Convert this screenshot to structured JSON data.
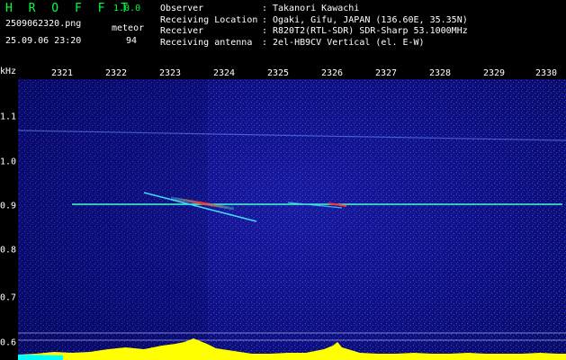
{
  "header": {
    "app_name": "H R O F F T",
    "version": "1.0.0",
    "filename": "2509062320.png",
    "datetime": "25.09.06 23:20",
    "detection_label": "meteor",
    "detection_count": "94",
    "info": [
      {
        "label": "Observer",
        "sep": ":",
        "value": "Takanori Kawachi"
      },
      {
        "label": "Receiving Location",
        "sep": ":",
        "value": "Ogaki, Gifu, JAPAN (136.60E, 35.35N)"
      },
      {
        "label": "Receiver",
        "sep": ":",
        "value": "R820T2(RTL-SDR) SDR-Sharp 53.1000MHz"
      },
      {
        "label": "Receiving antenna",
        "sep": ":",
        "value": "2el-HB9CV Vertical (el. E-W)"
      }
    ]
  },
  "axis": {
    "unit": "kHz",
    "time_ticks": [
      "2321",
      "2322",
      "2323",
      "2324",
      "2325",
      "2326",
      "2327",
      "2328",
      "2329",
      "2330"
    ],
    "freq_ticks": [
      "1.1",
      "1.0",
      "0.9",
      "0.8",
      "0.7",
      "0.6"
    ]
  },
  "colors": {
    "background": "#0f0f80",
    "noise_bright": "#3a6cff",
    "carrier": "#40ffd0",
    "echo_hot": "#ff3030",
    "level_bars": "#ffff00",
    "app_name": "#00ff3c"
  }
}
